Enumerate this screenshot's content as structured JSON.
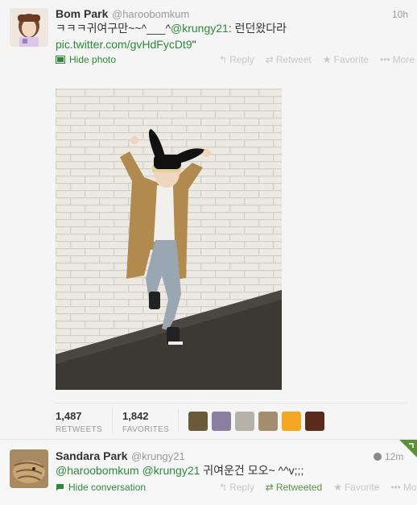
{
  "tweet": {
    "author_name": "Bom Park",
    "author_handle": "@haroobomkum",
    "time": "10h",
    "text_prefix": "ㅋㅋㅋ귀여구만~~^___^",
    "mention": "@krungy21",
    "text_suffix": ": 런던왔다라",
    "media_link": "pic.twitter.com/gvHdFycDt9",
    "quote_close": "\"",
    "hide_photo_label": "Hide photo",
    "actions": {
      "reply": "Reply",
      "retweet": "Retweet",
      "favorite": "Favorite",
      "more": "More"
    },
    "stats": {
      "retweets_count": "1,487",
      "retweets_label": "RETWEETS",
      "favorites_count": "1,842",
      "favorites_label": "FAVORITES"
    },
    "favoriters": [
      {
        "name": "faver-1",
        "color": "#6b5a3a"
      },
      {
        "name": "faver-2",
        "color": "#8a7fa0"
      },
      {
        "name": "faver-3",
        "color": "#b7b2a8"
      },
      {
        "name": "faver-4",
        "color": "#a58d70"
      },
      {
        "name": "faver-5",
        "color": "#f5a623"
      },
      {
        "name": "faver-6",
        "color": "#5a2a1c"
      }
    ]
  },
  "reply": {
    "author_name": "Sandara Park",
    "author_handle": "@krungy21",
    "time": "12m",
    "mention1": "@haroobomkum",
    "mention2": "@krungy21",
    "text": " 귀여운건 모오~ ^^v;;;",
    "hide_conversation_label": "Hide conversation",
    "actions": {
      "reply": "Reply",
      "retweeted": "Retweeted",
      "favorite": "Favorite",
      "more": "More"
    }
  },
  "colors": {
    "accent_green": "#2c8b3b",
    "retweeted_green": "#5c913b",
    "muted": "#c8c8c8"
  }
}
